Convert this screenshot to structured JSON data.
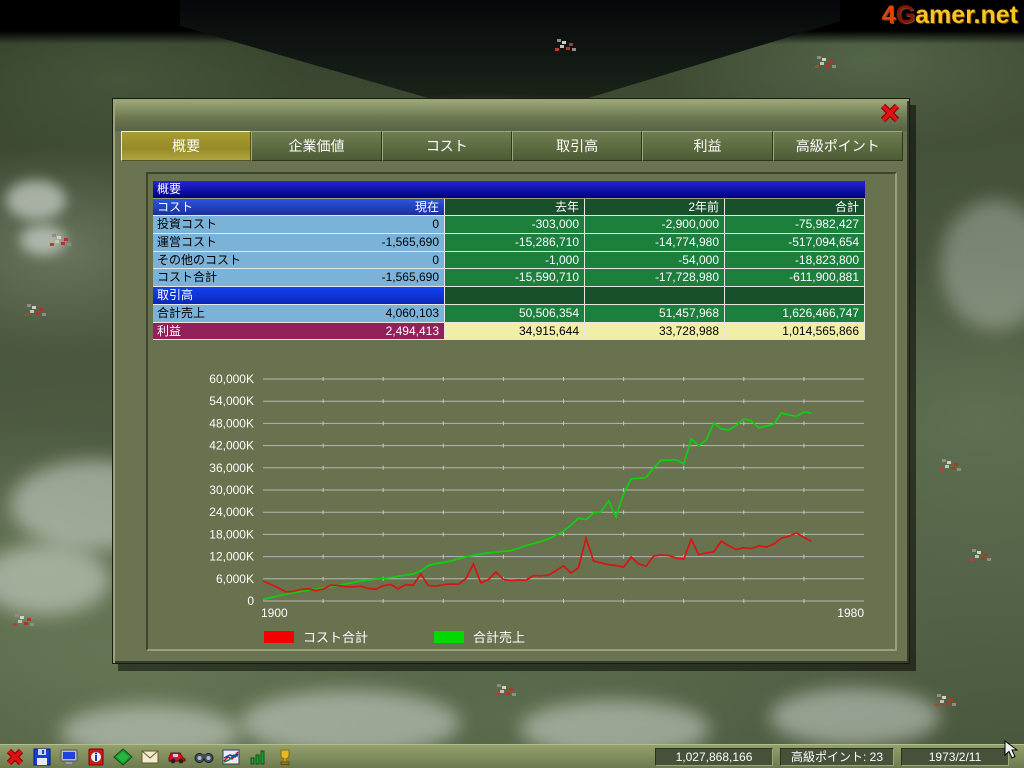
{
  "watermark": {
    "part1": "4",
    "part2": "G",
    "part3": "amer.net"
  },
  "window": {
    "close_icon": "x",
    "tabs": [
      {
        "id": "overview",
        "label": "概要",
        "selected": true
      },
      {
        "id": "company-value",
        "label": "企業価値",
        "selected": false
      },
      {
        "id": "costs",
        "label": "コスト",
        "selected": false
      },
      {
        "id": "turnover",
        "label": "取引高",
        "selected": false
      },
      {
        "id": "profit",
        "label": "利益",
        "selected": false
      },
      {
        "id": "premium-points",
        "label": "高級ポイント",
        "selected": false
      }
    ]
  },
  "table": {
    "title": "概要",
    "header": {
      "label": "コスト",
      "cols": [
        "現在",
        "去年",
        "2年前",
        "合計"
      ]
    },
    "rows": [
      {
        "type": "data",
        "label": "投資コスト",
        "values": [
          "0",
          "-303,000",
          "-2,900,000",
          "-75,982,427"
        ]
      },
      {
        "type": "data",
        "label": "運営コスト",
        "values": [
          "-1,565,690",
          "-15,286,710",
          "-14,774,980",
          "-517,094,654"
        ]
      },
      {
        "type": "data",
        "label": "その他のコスト",
        "values": [
          "0",
          "-1,000",
          "-54,000",
          "-18,823,800"
        ]
      },
      {
        "type": "data",
        "label": "コスト合計",
        "values": [
          "-1,565,690",
          "-15,590,710",
          "-17,728,980",
          "-611,900,881"
        ]
      },
      {
        "type": "section",
        "label": "取引高",
        "values": [
          "",
          "",
          "",
          ""
        ]
      },
      {
        "type": "data",
        "label": "合計売上",
        "values": [
          "4,060,103",
          "50,506,354",
          "51,457,968",
          "1,626,466,747"
        ]
      },
      {
        "type": "profit",
        "label": "利益",
        "values": [
          "2,494,413",
          "34,915,644",
          "33,728,988",
          "1,014,565,866"
        ]
      }
    ]
  },
  "chart_data": {
    "type": "line",
    "xlim": [
      1900,
      1980
    ],
    "ylim": [
      0,
      60000
    ],
    "x_label_left": "1900",
    "x_label_right": "1980",
    "y_ticks": [
      "60,000K",
      "54,000K",
      "48,000K",
      "42,000K",
      "36,000K",
      "30,000K",
      "24,000K",
      "18,000K",
      "12,000K",
      "6,000K",
      "0"
    ],
    "y_tick_values": [
      60000,
      54000,
      48000,
      42000,
      36000,
      30000,
      24000,
      18000,
      12000,
      6000,
      0
    ],
    "grid": true,
    "legend_position": "bottom",
    "years": [
      1900,
      1901,
      1902,
      1903,
      1904,
      1905,
      1906,
      1907,
      1908,
      1909,
      1910,
      1911,
      1912,
      1913,
      1914,
      1915,
      1916,
      1917,
      1918,
      1919,
      1920,
      1921,
      1922,
      1923,
      1924,
      1925,
      1926,
      1927,
      1928,
      1929,
      1930,
      1931,
      1932,
      1933,
      1934,
      1935,
      1936,
      1937,
      1938,
      1939,
      1940,
      1941,
      1942,
      1943,
      1944,
      1945,
      1946,
      1947,
      1948,
      1949,
      1950,
      1951,
      1952,
      1953,
      1954,
      1955,
      1956,
      1957,
      1958,
      1959,
      1960,
      1961,
      1962,
      1963,
      1964,
      1965,
      1966,
      1967,
      1968,
      1969,
      1970,
      1971,
      1972,
      1973
    ],
    "series": [
      {
        "name": "合計売上",
        "color": "#0fd00f",
        "unit": "K",
        "values": [
          400,
          900,
          1400,
          1800,
          2200,
          2600,
          2900,
          3200,
          3500,
          3900,
          4200,
          4600,
          5000,
          5400,
          5700,
          5900,
          6100,
          6300,
          6700,
          7000,
          7300,
          8200,
          9600,
          10100,
          10400,
          10800,
          11400,
          11900,
          12300,
          12700,
          13000,
          13200,
          13400,
          13600,
          14200,
          15000,
          15500,
          16100,
          16800,
          17800,
          18900,
          20500,
          22400,
          22000,
          23800,
          24100,
          27000,
          22700,
          29000,
          33000,
          33200,
          33400,
          36000,
          38100,
          38000,
          38200,
          37000,
          43800,
          42000,
          43500,
          48100,
          46500,
          46200,
          47500,
          49200,
          48700,
          46800,
          47300,
          47800,
          50800,
          50300,
          49900,
          51100,
          50800
        ]
      },
      {
        "name": "コスト合計",
        "color": "#d81414",
        "unit": "K",
        "values": [
          5400,
          4500,
          3600,
          2500,
          2600,
          3100,
          3300,
          2800,
          3200,
          4300,
          4200,
          3900,
          3800,
          4000,
          3400,
          3200,
          4100,
          4500,
          3300,
          4400,
          4300,
          7300,
          4200,
          4000,
          4400,
          4600,
          4500,
          6000,
          10000,
          4900,
          5800,
          7800,
          5800,
          5500,
          5700,
          5600,
          6900,
          6800,
          7000,
          8200,
          9500,
          7600,
          9000,
          17000,
          10800,
          10300,
          9800,
          9600,
          9200,
          11900,
          10000,
          9400,
          12200,
          12400,
          12300,
          11600,
          11300,
          16700,
          12500,
          13000,
          13300,
          16200,
          14900,
          13900,
          14400,
          14200,
          14900,
          14600,
          15400,
          17000,
          17500,
          18400,
          17200,
          16200
        ]
      }
    ],
    "legend": [
      {
        "label": "コスト合計",
        "color": "#f50000"
      },
      {
        "label": "合計売上",
        "color": "#00da00"
      }
    ]
  },
  "toolbar": {
    "icons": [
      "exit",
      "save",
      "display-options",
      "info",
      "map",
      "messages",
      "vehicles",
      "find",
      "graphs",
      "charts",
      "awards"
    ]
  },
  "statusbar": {
    "money": "1,027,868,166",
    "points": "高級ポイント: 23",
    "date": "1973/2/11"
  }
}
